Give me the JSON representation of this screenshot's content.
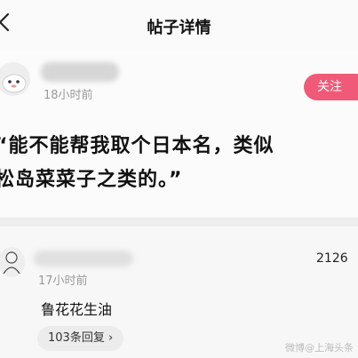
{
  "nav": {
    "title": "帖子详情",
    "back_icon": "chevron-left-icon"
  },
  "post": {
    "author_name": "",
    "time": "18小时前",
    "follow_label": "关注",
    "text": "“能不能帮我取个日本名，类似\n松岛菜菜子之类的。”"
  },
  "comment": {
    "author_name": "",
    "time": "17小时前",
    "likes": "2126",
    "text": "鲁花花生油",
    "replies_label": "103条回复 ›"
  },
  "watermark": "微博@上海头条",
  "colors": {
    "accent": "#f05a78",
    "muted": "#9a9a9a"
  }
}
